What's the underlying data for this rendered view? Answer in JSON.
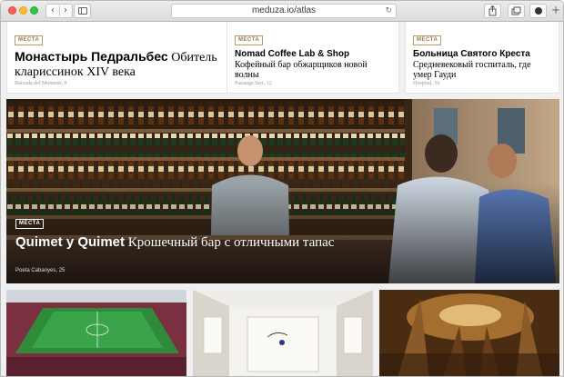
{
  "browser": {
    "url": "meduza.io/atlas",
    "reload_glyph": "↻",
    "back_glyph": "‹",
    "forward_glyph": "›",
    "newtab_glyph": "+"
  },
  "cards": [
    {
      "tag": "МЕСТА",
      "title_bold": "Монастырь Педральбес",
      "title_rest": " Обитель кларисcинок XIV века",
      "location": "Baixada del Monestir, 9"
    },
    {
      "tag": "МЕСТА",
      "title_bold": "Nomad Coffee Lab & Shop",
      "title_rest": " Кофейный бар обжарщиков новой волны",
      "location": "Passatge Sert, 12"
    },
    {
      "tag": "МЕСТА",
      "title_bold": "Больница Святого Креста",
      "title_rest": " Средневековый госпиталь, где умер Гауди",
      "location": "Hospital, 56"
    }
  ],
  "hero": {
    "tag": "МЕСТА",
    "title_bold": "Quimet y Quimet",
    "title_rest": " Крошечный бар с отличными тапас",
    "location": "Poeta Cabanyes, 25"
  },
  "colors": {
    "tag_border": "#b69a6c",
    "tag_text": "#9b7b45"
  }
}
